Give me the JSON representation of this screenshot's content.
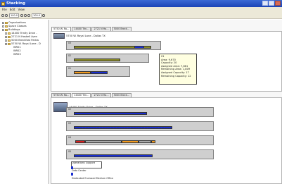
{
  "window": {
    "title": "Stacking"
  },
  "menu": [
    "File",
    "Edit",
    "View"
  ],
  "toolbar": {
    "box1": "100.0",
    "box2": "100.0"
  },
  "tree": {
    "items": [
      {
        "label": "Organizations",
        "level": 0
      },
      {
        "label": "Space Classes",
        "level": 0
      },
      {
        "label": "Buildings",
        "level": 0
      },
      {
        "label": "14400 Trinity Drive -",
        "level": 1
      },
      {
        "label": "2721 N Haskell Aven",
        "level": 1
      },
      {
        "label": "5000 Breckfast Parkw",
        "level": 1
      },
      {
        "label": "5750 W. Royal Lane - D",
        "level": 1
      },
      {
        "label": "WR01",
        "level": 2
      },
      {
        "label": "WR02",
        "level": 2
      },
      {
        "label": "WR03",
        "level": 2
      }
    ]
  },
  "top_pane": {
    "tabs": [
      "5750 W. Ro...",
      "14400 Trin...",
      "2721 N Ha...",
      "5000 Breck..."
    ],
    "building_title": "5750 W. Royal Lane - Dallas TX",
    "floors": [
      {
        "label": "03"
      },
      {
        "label": "02"
      },
      {
        "label": "01"
      }
    ]
  },
  "tooltip": {
    "lines": [
      "01",
      "Area: 9,670",
      "Capacity: 20",
      "Assigned Area: 7,861",
      "Remaining Area: 1,809",
      "Assigned Capacity: 17",
      "Remaining Capacity: 12"
    ]
  },
  "bottom_pane": {
    "tabs": [
      "5750 W. Ro...",
      "14400 Trin...",
      "2721 N Ha...",
      "5000 Breck..."
    ],
    "building_title": "14400 Trinity Drive - Dallas TX",
    "floors": [
      {
        "label": "02"
      },
      {
        "label": "03"
      },
      {
        "label": "04"
      },
      {
        "label": "05"
      }
    ],
    "list": [
      "Operations Support",
      "Data Center",
      "Dedicated Enclosed Medium Office"
    ]
  },
  "colors": {
    "olive": "#8c8c25",
    "blue": "#1a2fd0",
    "orange": "#f29a1f",
    "red": "#d81f1f",
    "gray": "#a9a9a9"
  }
}
